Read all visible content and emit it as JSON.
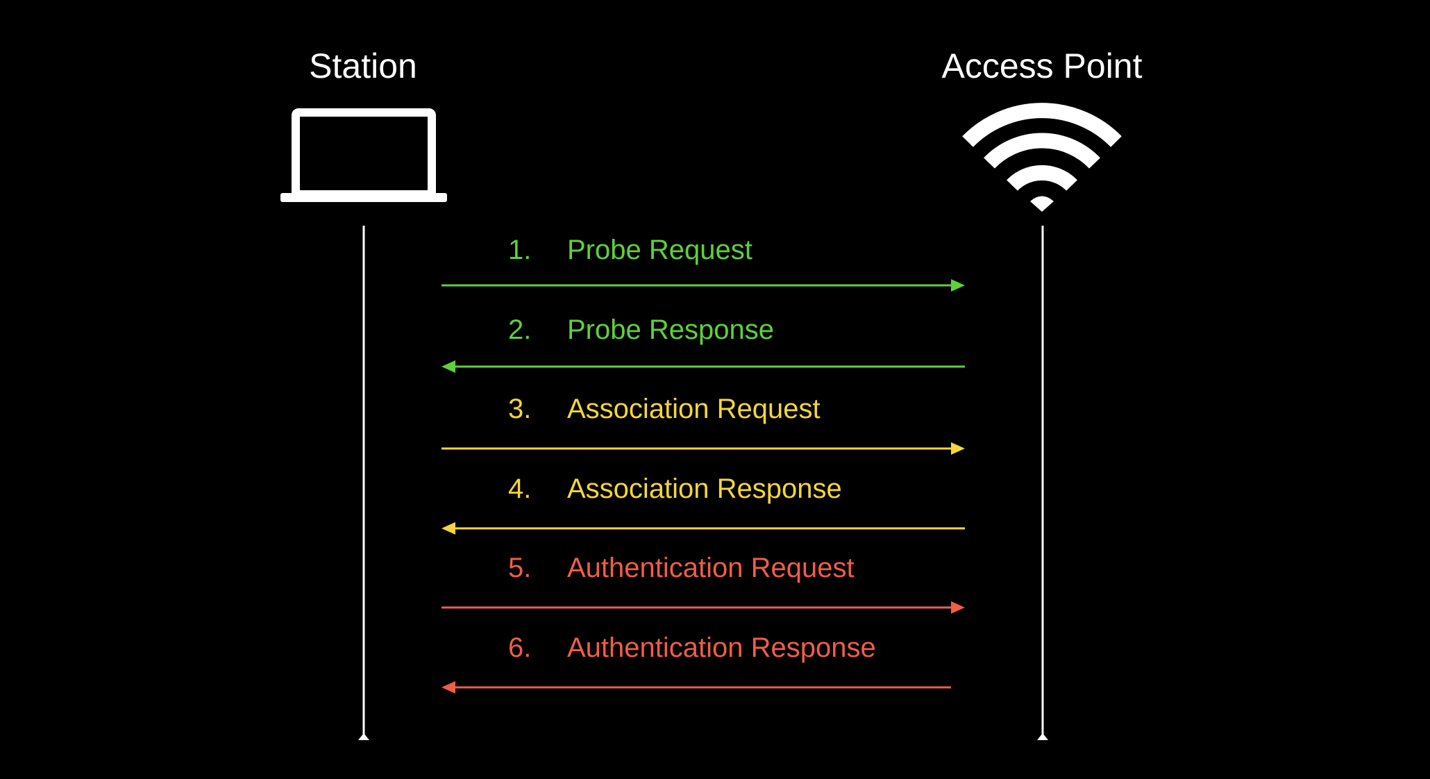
{
  "participants": {
    "station": {
      "label": "Station",
      "icon": "laptop-icon"
    },
    "access_point": {
      "label": "Access Point",
      "icon": "wifi-icon"
    }
  },
  "colors": {
    "background": "#000000",
    "foreground": "#ffffff",
    "probe": "#5ed13a",
    "association": "#f5d63a",
    "authentication": "#ef5e47"
  },
  "messages": [
    {
      "number": "1.",
      "label": "Probe Request",
      "direction": "to-ap",
      "color": "#5ed13a"
    },
    {
      "number": "2.",
      "label": "Probe Response",
      "direction": "to-station",
      "color": "#5ed13a"
    },
    {
      "number": "3.",
      "label": "Association Request",
      "direction": "to-ap",
      "color": "#f5d63a"
    },
    {
      "number": "4.",
      "label": "Association Response",
      "direction": "to-station",
      "color": "#f5d63a"
    },
    {
      "number": "5.",
      "label": "Authentication Request",
      "direction": "to-ap",
      "color": "#ef5e47"
    },
    {
      "number": "6.",
      "label": "Authentication Response",
      "direction": "to-station",
      "color": "#ef5e47"
    }
  ]
}
